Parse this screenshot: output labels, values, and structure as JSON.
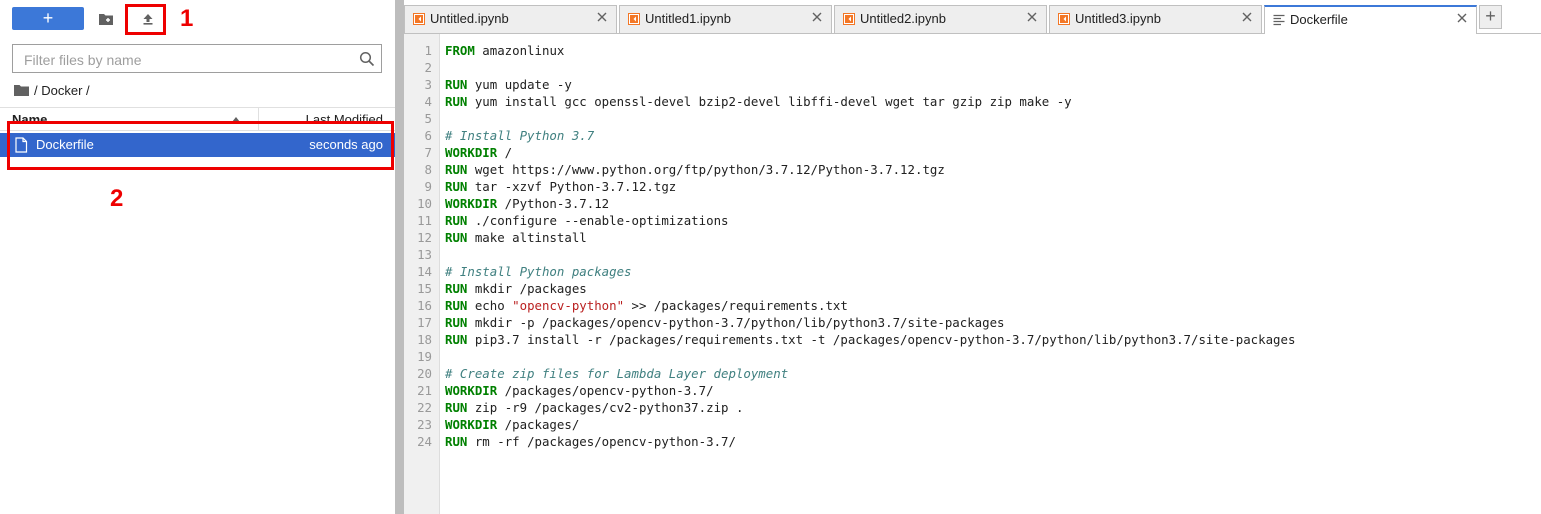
{
  "sidebar": {
    "new_button": "+",
    "filter_placeholder": "Filter files by name",
    "breadcrumb": "/ Docker /",
    "column_name": "Name",
    "column_modified": "Last Modified",
    "files": [
      {
        "name": "Dockerfile",
        "modified": "seconds ago"
      }
    ]
  },
  "annotations": {
    "label_1": "1",
    "label_2": "2",
    "color": "#ee0000"
  },
  "tabs": [
    {
      "label": "Untitled.ipynb",
      "icon": "notebook-icon",
      "active": false
    },
    {
      "label": "Untitled1.ipynb",
      "icon": "notebook-icon",
      "active": false
    },
    {
      "label": "Untitled2.ipynb",
      "icon": "notebook-icon",
      "active": false
    },
    {
      "label": "Untitled3.ipynb",
      "icon": "notebook-icon",
      "active": false
    },
    {
      "label": "Dockerfile",
      "icon": "text-file-icon",
      "active": true
    }
  ],
  "add_tab": "+",
  "editor": {
    "lines": [
      [
        [
          "kw",
          "FROM"
        ],
        [
          "t",
          " amazonlinux"
        ]
      ],
      [],
      [
        [
          "kw",
          "RUN"
        ],
        [
          "t",
          " yum update -y"
        ]
      ],
      [
        [
          "kw",
          "RUN"
        ],
        [
          "t",
          " yum install gcc openssl-devel bzip2-devel libffi-devel wget tar gzip zip make -y"
        ]
      ],
      [],
      [
        [
          "cm",
          "# Install Python 3.7"
        ]
      ],
      [
        [
          "kw",
          "WORKDIR"
        ],
        [
          "t",
          " /"
        ]
      ],
      [
        [
          "kw",
          "RUN"
        ],
        [
          "t",
          " wget https://www.python.org/ftp/python/3.7.12/Python-3.7.12.tgz"
        ]
      ],
      [
        [
          "kw",
          "RUN"
        ],
        [
          "t",
          " tar -xzvf Python-3.7.12.tgz"
        ]
      ],
      [
        [
          "kw",
          "WORKDIR"
        ],
        [
          "t",
          " /Python-3.7.12"
        ]
      ],
      [
        [
          "kw",
          "RUN"
        ],
        [
          "t",
          " ./configure --enable-optimizations"
        ]
      ],
      [
        [
          "kw",
          "RUN"
        ],
        [
          "t",
          " make altinstall"
        ]
      ],
      [],
      [
        [
          "cm",
          "# Install Python packages"
        ]
      ],
      [
        [
          "kw",
          "RUN"
        ],
        [
          "t",
          " mkdir /packages"
        ]
      ],
      [
        [
          "kw",
          "RUN"
        ],
        [
          "t",
          " echo "
        ],
        [
          "st",
          "\"opencv-python\""
        ],
        [
          "t",
          " >> /packages/requirements.txt"
        ]
      ],
      [
        [
          "kw",
          "RUN"
        ],
        [
          "t",
          " mkdir -p /packages/opencv-python-3.7/python/lib/python3.7/site-packages"
        ]
      ],
      [
        [
          "kw",
          "RUN"
        ],
        [
          "t",
          " pip3.7 install -r /packages/requirements.txt -t /packages/opencv-python-3.7/python/lib/python3.7/site-packages"
        ]
      ],
      [],
      [
        [
          "cm",
          "# Create zip files for Lambda Layer deployment"
        ]
      ],
      [
        [
          "kw",
          "WORKDIR"
        ],
        [
          "t",
          " /packages/opencv-python-3.7/"
        ]
      ],
      [
        [
          "kw",
          "RUN"
        ],
        [
          "t",
          " zip -r9 /packages/cv2-python37.zip ."
        ]
      ],
      [
        [
          "kw",
          "WORKDIR"
        ],
        [
          "t",
          " /packages/"
        ]
      ],
      [
        [
          "kw",
          "RUN"
        ],
        [
          "t",
          " rm -rf /packages/opencv-python-3.7/"
        ]
      ]
    ]
  }
}
